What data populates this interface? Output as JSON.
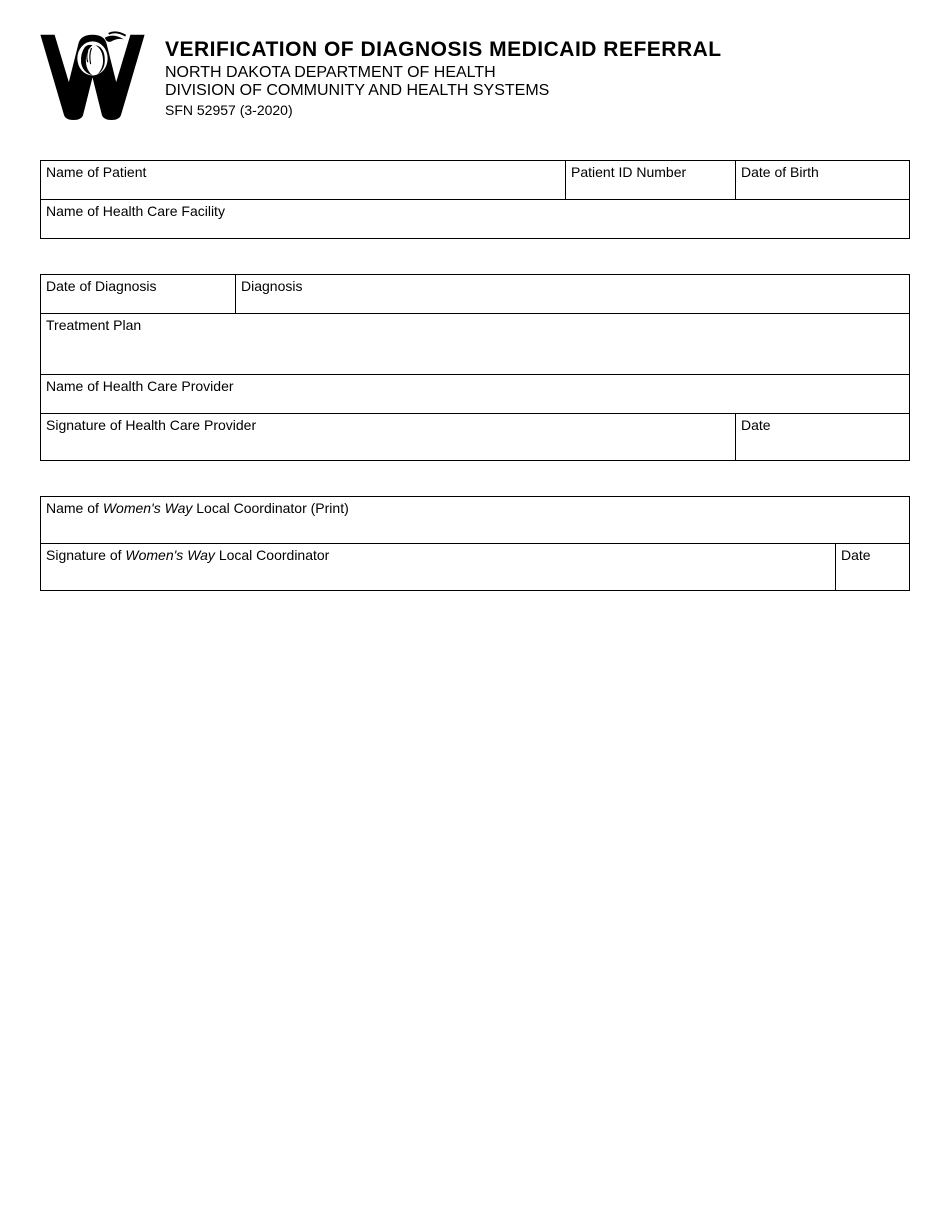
{
  "header": {
    "title": "VERIFICATION OF DIAGNOSIS MEDICAID REFERRAL",
    "subtitle": "NORTH DAKOTA DEPARTMENT OF HEALTH",
    "division": "DIVISION OF COMMUNITY AND HEALTH SYSTEMS",
    "form_number": "SFN 52957 (3-2020)"
  },
  "section1": {
    "name_of_patient": "Name of Patient",
    "patient_id_number": "Patient ID Number",
    "date_of_birth": "Date of Birth",
    "name_of_facility": "Name of Health Care Facility"
  },
  "section2": {
    "date_of_diagnosis": "Date of Diagnosis",
    "diagnosis": "Diagnosis",
    "treatment_plan": "Treatment Plan",
    "name_of_provider": "Name of Health Care Provider",
    "signature_of_provider": "Signature of Health Care Provider",
    "date": "Date"
  },
  "section3": {
    "name_of_coordinator_prefix": "Name of ",
    "womens_way": "Women's Way",
    "name_of_coordinator_suffix": " Local Coordinator (Print)",
    "signature_prefix": "Signature of ",
    "signature_suffix": " Local Coordinator",
    "date": "Date"
  }
}
